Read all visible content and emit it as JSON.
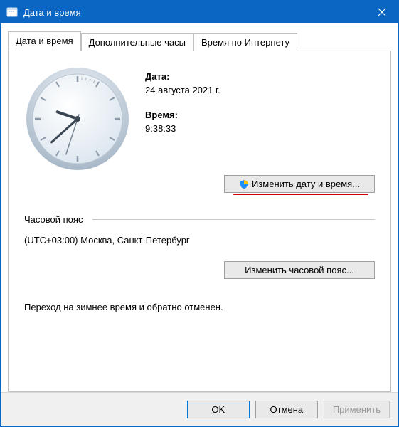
{
  "title": "Дата и время",
  "tabs": {
    "datetime": "Дата и время",
    "additional": "Дополнительные часы",
    "internet": "Время по Интернету"
  },
  "date_section": {
    "label": "Дата:",
    "value": "24 августа 2021 г."
  },
  "time_section": {
    "label": "Время:",
    "value": "9:38:33"
  },
  "buttons": {
    "change_datetime": "Изменить дату и время...",
    "change_tz": "Изменить часовой пояс..."
  },
  "timezone": {
    "label": "Часовой пояс",
    "value": "(UTC+03:00) Москва, Санкт-Петербург"
  },
  "dst_note": "Переход на зимнее время и обратно отменен.",
  "dialog_buttons": {
    "ok": "OK",
    "cancel": "Отмена",
    "apply": "Применить"
  }
}
